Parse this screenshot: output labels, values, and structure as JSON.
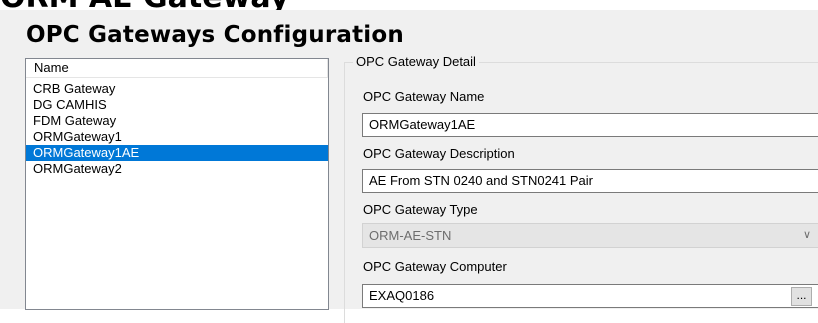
{
  "background_title": "ORM AE Gateway",
  "dialog": {
    "title": "OPC Gateways Configuration"
  },
  "gateway_list": {
    "column_header": "Name",
    "items": [
      {
        "label": "CRB Gateway",
        "selected": false
      },
      {
        "label": "DG CAMHIS",
        "selected": false
      },
      {
        "label": "FDM Gateway",
        "selected": false
      },
      {
        "label": "ORMGateway1",
        "selected": false
      },
      {
        "label": "ORMGateway1AE",
        "selected": true
      },
      {
        "label": "ORMGateway2",
        "selected": false
      }
    ]
  },
  "detail": {
    "group_title": "OPC Gateway Detail",
    "name_label": "OPC Gateway Name",
    "name_value": "ORMGateway1AE",
    "description_label": "OPC Gateway Description",
    "description_value": "AE From STN 0240 and STN0241 Pair",
    "type_label": "OPC Gateway Type",
    "type_value": "ORM-AE-STN",
    "computer_label": "OPC Gateway Computer",
    "computer_value": "EXAQ0186",
    "browse_label": "..."
  },
  "colors": {
    "selection": "#0078d7",
    "window_bg": "#f0f0f0"
  },
  "icons": {
    "combo_arrow": "chevron-down-icon"
  }
}
